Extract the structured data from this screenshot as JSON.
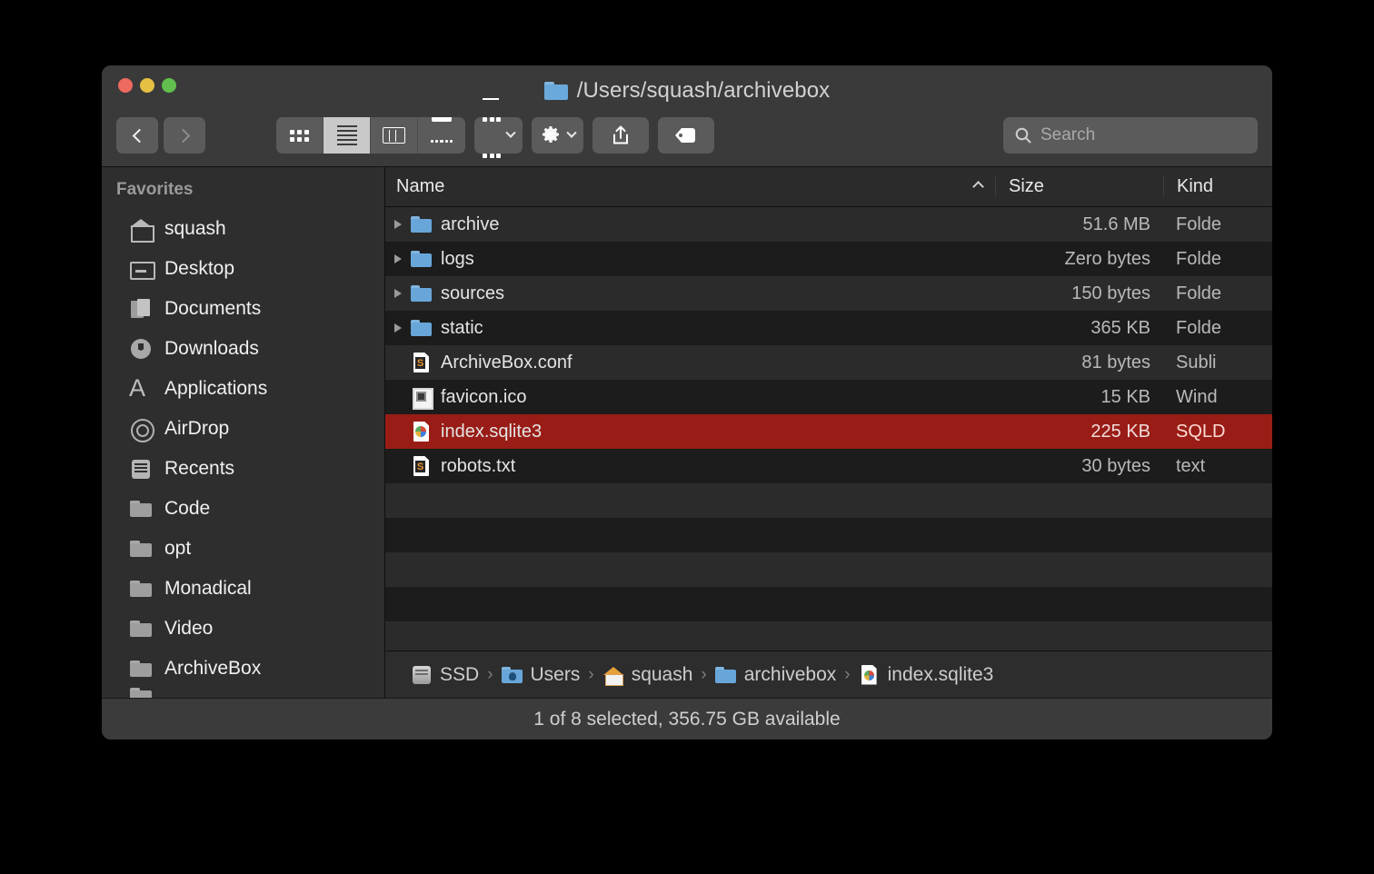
{
  "window": {
    "title": "/Users/squash/archivebox",
    "title_icon": "folder-icon",
    "traffic_lights": [
      "close-button",
      "minimize-button",
      "maximize-button"
    ]
  },
  "toolbar": {
    "back_label": "",
    "forward_label": "",
    "view_modes": [
      {
        "name": "icon-view",
        "active": false
      },
      {
        "name": "list-view",
        "active": true
      },
      {
        "name": "column-view",
        "active": false
      },
      {
        "name": "gallery-view",
        "active": false
      }
    ],
    "group_by": "group-by-button",
    "action": "action-gear-button",
    "share": "share-button",
    "tags": "tags-button",
    "search": {
      "placeholder": "Search",
      "value": ""
    }
  },
  "sidebar": {
    "header": "Favorites",
    "items": [
      {
        "label": "squash",
        "icon": "home-icon"
      },
      {
        "label": "Desktop",
        "icon": "desktop-icon"
      },
      {
        "label": "Documents",
        "icon": "documents-icon"
      },
      {
        "label": "Downloads",
        "icon": "downloads-icon"
      },
      {
        "label": "Applications",
        "icon": "applications-icon"
      },
      {
        "label": "AirDrop",
        "icon": "airdrop-icon"
      },
      {
        "label": "Recents",
        "icon": "recents-icon"
      },
      {
        "label": "Code",
        "icon": "folder-icon"
      },
      {
        "label": "opt",
        "icon": "folder-icon"
      },
      {
        "label": "Monadical",
        "icon": "folder-icon"
      },
      {
        "label": "Video",
        "icon": "folder-icon"
      },
      {
        "label": "ArchiveBox",
        "icon": "folder-icon"
      }
    ]
  },
  "file_list": {
    "columns": {
      "name": "Name",
      "size": "Size",
      "kind": "Kind"
    },
    "sort": "ascending",
    "rows": [
      {
        "name": "archive",
        "size": "51.6 MB",
        "kind": "Folde",
        "icon": "folder-icon",
        "expandable": true,
        "selected": false
      },
      {
        "name": "logs",
        "size": "Zero bytes",
        "kind": "Folde",
        "icon": "folder-icon",
        "expandable": true,
        "selected": false
      },
      {
        "name": "sources",
        "size": "150 bytes",
        "kind": "Folde",
        "icon": "folder-icon",
        "expandable": true,
        "selected": false
      },
      {
        "name": "static",
        "size": "365 KB",
        "kind": "Folde",
        "icon": "folder-icon",
        "expandable": true,
        "selected": false
      },
      {
        "name": "ArchiveBox.conf",
        "size": "81 bytes",
        "kind": "Subli",
        "icon": "sublime-document-icon",
        "expandable": false,
        "selected": false
      },
      {
        "name": "favicon.ico",
        "size": "15 KB",
        "kind": "Wind",
        "icon": "image-document-icon",
        "expandable": false,
        "selected": false
      },
      {
        "name": "index.sqlite3",
        "size": "225 KB",
        "kind": "SQLD",
        "icon": "sqlite-document-icon",
        "expandable": false,
        "selected": true
      },
      {
        "name": "robots.txt",
        "size": "30 bytes",
        "kind": "text",
        "icon": "sublime-document-icon",
        "expandable": false,
        "selected": false
      }
    ]
  },
  "path_bar": {
    "items": [
      {
        "label": "SSD",
        "icon": "drive-icon"
      },
      {
        "label": "Users",
        "icon": "users-folder-icon"
      },
      {
        "label": "squash",
        "icon": "home-folder-icon"
      },
      {
        "label": "archivebox",
        "icon": "folder-icon"
      },
      {
        "label": "index.sqlite3",
        "icon": "sqlite-document-icon"
      }
    ],
    "separator": "›"
  },
  "status_bar": {
    "text": "1 of 8 selected, 356.75 GB available"
  },
  "colors": {
    "selection": "#991d16",
    "window_bg": "#232323",
    "titlebar": "#3a3a3a",
    "sidebar": "#2e2e2e",
    "row_even": "#2b2b2b",
    "row_odd": "#1c1c1c"
  }
}
